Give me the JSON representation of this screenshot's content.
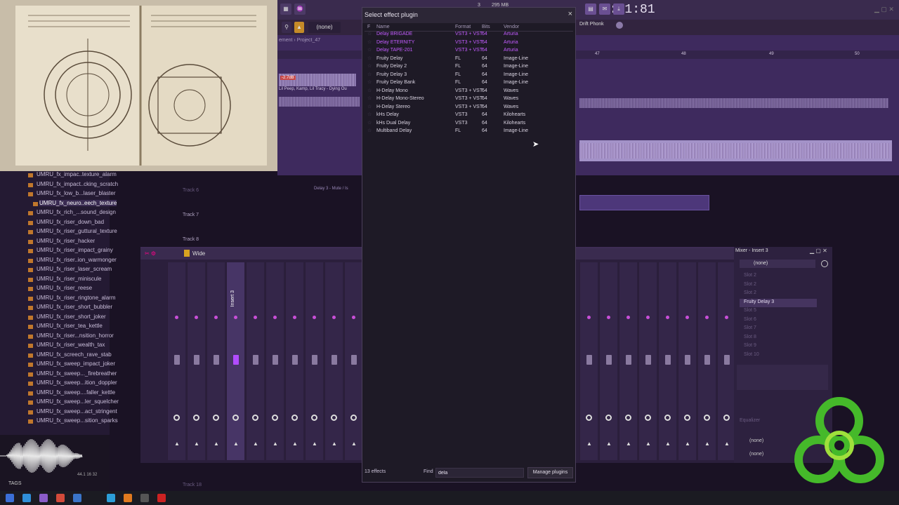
{
  "dialog": {
    "title": "Select effect plugin",
    "close_glyph": "×",
    "headers": {
      "fav": "F",
      "name": "Name",
      "format": "Format",
      "bits": "Bits",
      "vendor": "Vendor"
    },
    "rows": [
      {
        "name": "Delay BRIGADE",
        "format": "VST3 + VST",
        "bits": "64",
        "vendor": "Arturia",
        "style": "arturia"
      },
      {
        "name": "Delay ETERNITY",
        "format": "VST3 + VST",
        "bits": "64",
        "vendor": "Arturia",
        "style": "arturia"
      },
      {
        "name": "Delay TAPE-201",
        "format": "VST3 + VST",
        "bits": "64",
        "vendor": "Arturia",
        "style": "arturia"
      },
      {
        "name": "Fruity Delay",
        "format": "FL",
        "bits": "64",
        "vendor": "Image-Line",
        "style": "normal"
      },
      {
        "name": "Fruity Delay 2",
        "format": "FL",
        "bits": "64",
        "vendor": "Image-Line",
        "style": "normal"
      },
      {
        "name": "Fruity Delay 3",
        "format": "FL",
        "bits": "64",
        "vendor": "Image-Line",
        "style": "normal"
      },
      {
        "name": "Fruity Delay Bank",
        "format": "FL",
        "bits": "64",
        "vendor": "Image-Line",
        "style": "normal"
      },
      {
        "name": "H-Delay Mono",
        "format": "VST3 + VST",
        "bits": "64",
        "vendor": "Waves",
        "style": "normal"
      },
      {
        "name": "H-Delay Mono-Stereo",
        "format": "VST3 + VST",
        "bits": "64",
        "vendor": "Waves",
        "style": "normal"
      },
      {
        "name": "H-Delay Stereo",
        "format": "VST3 + VST",
        "bits": "64",
        "vendor": "Waves",
        "style": "normal"
      },
      {
        "name": "kHs Delay",
        "format": "VST3",
        "bits": "64",
        "vendor": "Kilohearts",
        "style": "normal"
      },
      {
        "name": "kHs Dual Delay",
        "format": "VST3",
        "bits": "64",
        "vendor": "Kilohearts",
        "style": "normal"
      },
      {
        "name": "Multiband Delay",
        "format": "FL",
        "bits": "64",
        "vendor": "Image-Line",
        "style": "normal"
      }
    ],
    "count_label": "13 effects",
    "find_label": "Find",
    "find_value": "dela",
    "manage_label": "Manage plugins"
  },
  "toolbar": {
    "time": "1:01:81",
    "pattern": "(none)",
    "project": "Project_47",
    "breadcrumb_prefix": "ement",
    "memory": "295 MB",
    "cpu_digit": "3",
    "drift": "Drift Phonk"
  },
  "playlist": {
    "tracks": [
      "Track 6",
      "Track 7",
      "Track 8",
      "Track 18"
    ],
    "clip_label": "Lil Peep, Kamp, Lil Tracy - Dying Ou",
    "clip_gain": "-2.7dB",
    "delay_clip": "Delay 3 - Mute / Is",
    "bar_numbers": [
      "47",
      "48",
      "49",
      "50"
    ]
  },
  "browser": {
    "items": [
      "UMRU_fx_impac..texture_alarm",
      "UMRU_fx_impact..cking_scratch",
      "UMRU_fx_low_b...laser_blaster",
      "UMRU_fx_neuro..eech_texture",
      "UMRU_fx_rich_...sound_design",
      "UMRU_fx_riser_down_bad",
      "UMRU_fx_riser_guttural_texture",
      "UMRU_fx_riser_hacker",
      "UMRU_fx_riser_impact_grainy",
      "UMRU_fx_riser..ion_warmonger",
      "UMRU_fx_riser_laser_scream",
      "UMRU_fx_riser_miniscule",
      "UMRU_fx_riser_reese",
      "UMRU_fx_riser_ringtone_alarm",
      "UMRU_fx_riser_short_bubbler",
      "UMRU_fx_riser_short_joker",
      "UMRU_fx_riser_tea_kettle",
      "UMRU_fx_riser...nsition_horror",
      "UMRU_fx_riser_wealth_tax",
      "UMRU_fx_screech_rave_stab",
      "UMRU_fx_sweep_impact_joker",
      "UMRU_fx_sweep..._firebreather",
      "UMRU_fx_sweep...ition_doppler",
      "UMRU_fx_sweep....faller_kettle",
      "UMRU_fx_sweep...ler_squelcher",
      "UMRU_fx_sweep...act_stringent",
      "UMRU_fx_sweep...sition_sparks"
    ],
    "selected_index": 3,
    "tags_label": "TAGS",
    "sample_info": "44.1 16 32"
  },
  "mixer": {
    "preset": "Wide",
    "selected_insert": "Insert 3"
  },
  "insert_panel": {
    "title": "Mixer - Insert 3",
    "preset": "(none)",
    "slots": [
      "Slot 2",
      "Slot 2",
      "Slot 2",
      "Fruity Delay 3",
      "Slot 5",
      "Slot 6",
      "Slot 7",
      "Slot 8",
      "Slot 9",
      "Slot 10"
    ],
    "active_slot": 3,
    "equalizer": "Equalizer",
    "route_a": "(none)",
    "route_b": "(none)"
  },
  "colors": {
    "arturia": "#c35cff",
    "accent": "#b14cff"
  }
}
